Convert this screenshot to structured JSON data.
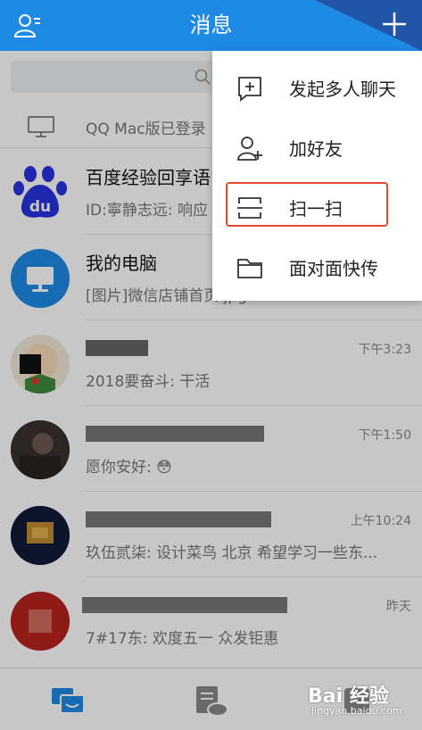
{
  "header": {
    "title": "消息",
    "color": "#1e8ae6"
  },
  "search": {
    "placeholder": "搜"
  },
  "device_row": {
    "text": "QQ Mac版已登录"
  },
  "chats": [
    {
      "name": "百度经验回享语",
      "preview": "ID:寧静志远: 响应",
      "time": ""
    },
    {
      "name": "我的电脑",
      "preview": "[图片]微信店铺首页.jpg",
      "time": ""
    },
    {
      "name": "",
      "preview": "2018要奋斗: 干活",
      "time": "下午3:23"
    },
    {
      "name": "",
      "preview": "愿你安好: 😳",
      "time": "下午1:50"
    },
    {
      "name": "",
      "preview": "玖伍贰柒: 设计菜鸟  北京 希望学习一些东...",
      "time": "上午10:24"
    },
    {
      "name": "",
      "preview": "7#17东:      欢度五一   众发钜惠",
      "time": "昨天"
    }
  ],
  "menu": {
    "items": [
      {
        "label": "发起多人聊天",
        "icon": "add-chat-icon"
      },
      {
        "label": "加好友",
        "icon": "add-friend-icon"
      },
      {
        "label": "扫一扫",
        "icon": "scan-icon",
        "highlighted": true
      },
      {
        "label": "面对面快传",
        "icon": "folder-icon"
      }
    ],
    "highlight_color": "#e24a2d"
  },
  "tabs": [
    {
      "icon": "messages-tab-icon",
      "active": true
    },
    {
      "icon": "contacts-tab-icon",
      "active": false
    },
    {
      "icon": "explore-tab-icon",
      "active": false
    }
  ],
  "watermark": {
    "brand": "Bai 经验",
    "site": "jingyan.baidu.com"
  }
}
